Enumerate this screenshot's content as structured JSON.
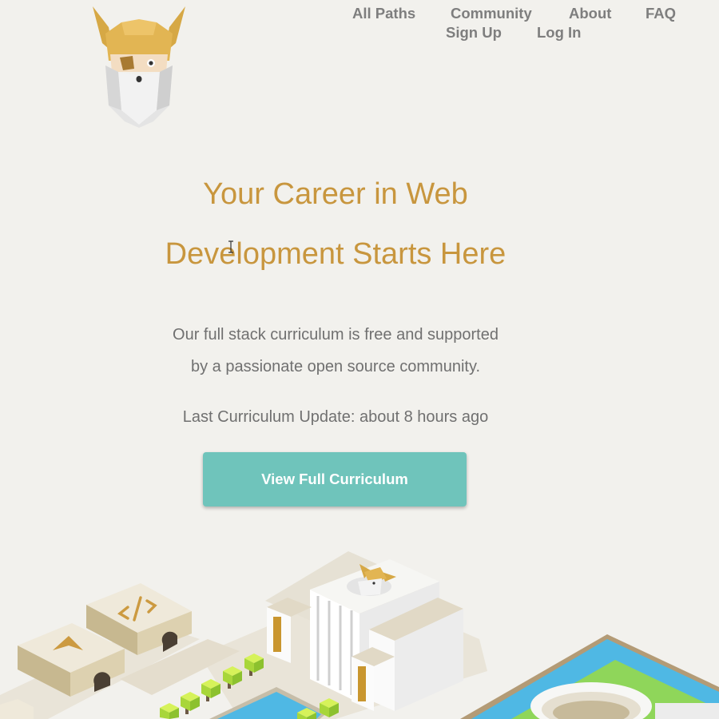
{
  "header": {
    "logo": {
      "icon": "odin-viking-logo-icon"
    },
    "nav": {
      "all_paths": "All Paths",
      "community": "Community",
      "about": "About",
      "faq": "FAQ",
      "sign_up": "Sign Up",
      "log_in": "Log In"
    }
  },
  "hero": {
    "title_line1": "Your Career in Web",
    "title_line2": "Development Starts Here",
    "subtitle_line1": "Our full stack curriculum is free and supported",
    "subtitle_line2": "by a passionate open source community.",
    "last_update": "Last Curriculum Update: about 8 hours ago",
    "cta_label": "View Full Curriculum"
  },
  "illustration": {
    "name": "isometric-city-illustration",
    "badges": [
      "code-brackets-icon",
      "odin-viking-logo-icon",
      "arrow-chevron-icon"
    ]
  },
  "colors": {
    "background": "#f2f1ed",
    "accent_gold": "#c8963e",
    "nav_text": "#7e7e7e",
    "body_text": "#707070",
    "cta_background": "#6fc4bb",
    "cta_text": "#ffffff",
    "water": "#4fb8e4",
    "grass": "#8fd65a"
  }
}
